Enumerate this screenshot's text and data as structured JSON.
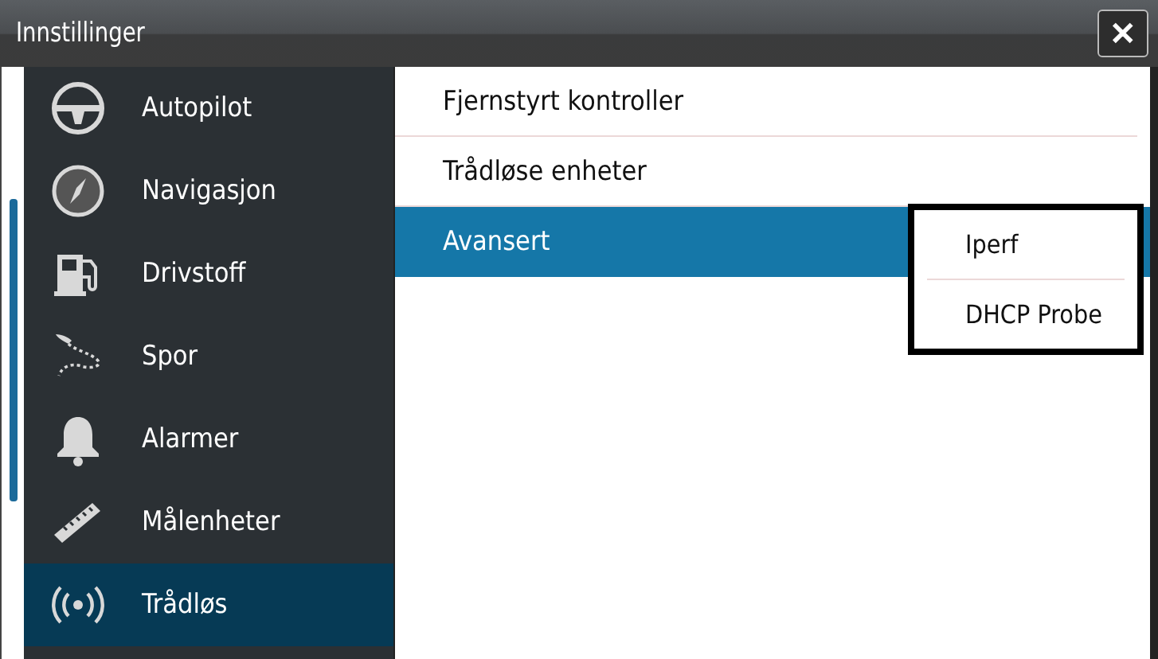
{
  "window": {
    "title": "Innstillinger",
    "close": "✕"
  },
  "sidebar": {
    "items": [
      {
        "label": "Autopilot",
        "selected": false
      },
      {
        "label": "Navigasjon",
        "selected": false
      },
      {
        "label": "Drivstoff",
        "selected": false
      },
      {
        "label": "Spor",
        "selected": false
      },
      {
        "label": "Alarmer",
        "selected": false
      },
      {
        "label": "Målenheter",
        "selected": false
      },
      {
        "label": "Trådløs",
        "selected": true
      }
    ]
  },
  "options": [
    {
      "label": "Fjernstyrt kontroller",
      "selected": false
    },
    {
      "label": "Trådløse enheter",
      "selected": false
    },
    {
      "label": "Avansert",
      "selected": true
    }
  ],
  "popup_menu": {
    "items": [
      {
        "label": "Iperf"
      },
      {
        "label": "DHCP Probe"
      }
    ]
  }
}
